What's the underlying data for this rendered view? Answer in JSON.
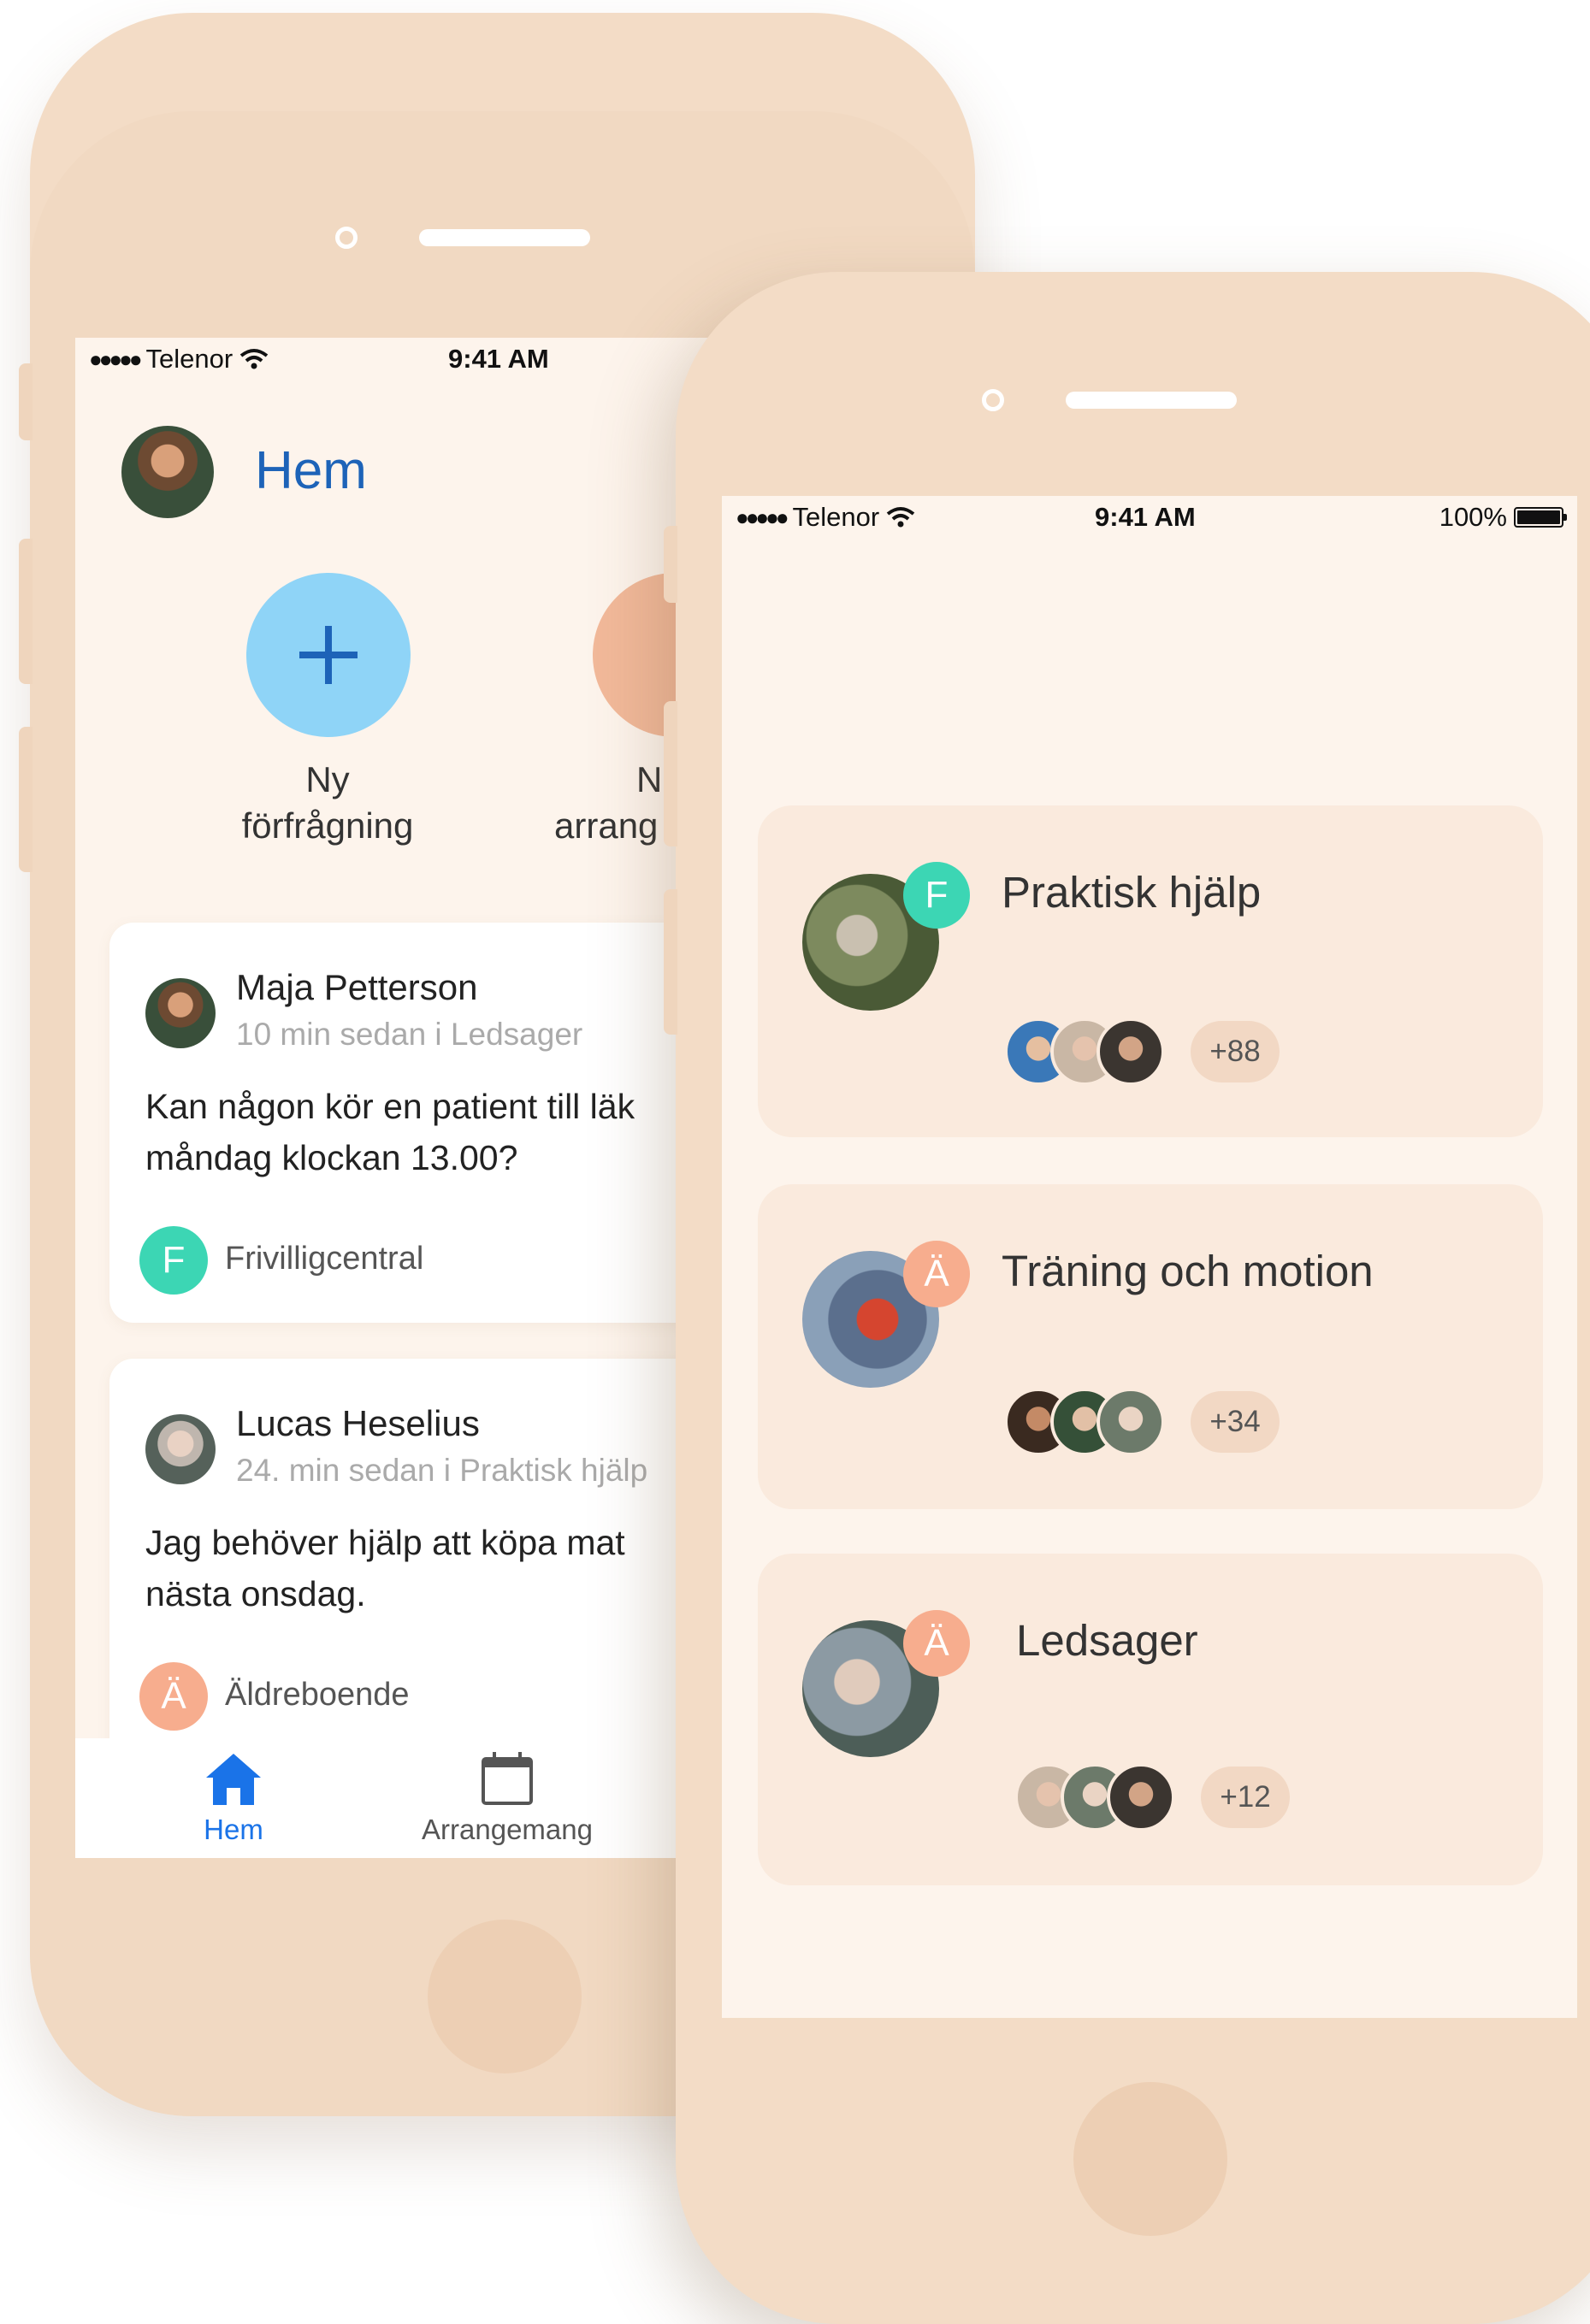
{
  "colors": {
    "frame": "#f3dcc6",
    "screen": "#fdf4ec",
    "accent_blue": "#1d63b8",
    "plus_circle": "#8fd4f7",
    "calendar_circle": "#f2b99a",
    "badge_green": "#3cd6b4",
    "badge_orange": "#f7ad8e",
    "tab_active": "#1a73e8",
    "group_card": "#faeadd"
  },
  "back_phone": {
    "status": {
      "carrier": "Telenor",
      "time": "9:41 AM"
    },
    "header": {
      "title": "Hem",
      "avatar_icon": "user-avatar"
    },
    "actions": [
      {
        "line1": "Ny",
        "line2": "förfrågning",
        "icon": "plus-icon"
      },
      {
        "line1": "N",
        "line2": "arrang",
        "icon": "calendar-add-icon"
      }
    ],
    "posts": [
      {
        "name": "Maja Petterson",
        "meta": "10 min sedan i Ledsager",
        "line1": "Kan någon kör en patient till läk",
        "line2": "måndag klockan 13.00?",
        "badge": "F",
        "org": "Frivilligcentral"
      },
      {
        "name": "Lucas Heselius",
        "meta": "24. min sedan i Praktisk hjälp",
        "line1": "Jag behöver hjälp att köpa mat",
        "line2": "nästa onsdag.",
        "badge": "Ä",
        "org": "Äldreboende"
      }
    ],
    "tabs": [
      {
        "label": "Hem",
        "icon": "home-icon",
        "active": true
      },
      {
        "label": "Arrangemang",
        "icon": "calendar-icon",
        "active": false
      }
    ]
  },
  "front_phone": {
    "status": {
      "carrier": "Telenor",
      "time": "9:41 AM",
      "battery": "100%"
    },
    "groups": [
      {
        "title": "Praktisk hjälp",
        "badge": "F",
        "count": "+88"
      },
      {
        "title": "Träning och motion",
        "badge": "Ä",
        "count": "+34"
      },
      {
        "title": "Ledsager",
        "badge": "Ä",
        "count": "+12"
      }
    ]
  }
}
